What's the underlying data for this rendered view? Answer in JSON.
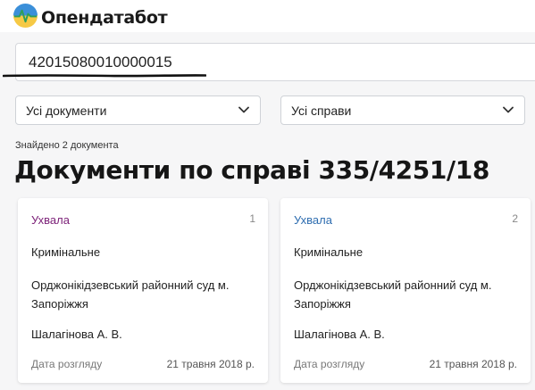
{
  "app": {
    "name": "Опендатабот"
  },
  "search": {
    "value": "42015080010000015"
  },
  "filters": {
    "documents_select": "Усі документи",
    "cases_select": "Усі справи"
  },
  "results": {
    "found_text": "Знайдено 2 документа",
    "title": "Документи по справі 335/4251/18"
  },
  "cards": [
    {
      "number": "1",
      "type": "Ухвала",
      "type_color": "#7b1f77",
      "category": "Кримінальне",
      "court": "Орджонікідзевський районний суд м. Запоріжжя",
      "judge": "Шалагінова А. В.",
      "date_label": "Дата розгляду",
      "date": "21 травня 2018 р."
    },
    {
      "number": "2",
      "type": "Ухвала",
      "type_color": "#2e6db0",
      "category": "Кримінальне",
      "court": "Орджонікідзевський районний суд м. Запоріжжя",
      "judge": "Шалагінова А. В.",
      "date_label": "Дата розгляду",
      "date": "21 травня 2018 р."
    }
  ],
  "colors": {
    "logo_blue": "#3b8fd9",
    "logo_yellow": "#f6c945",
    "logo_green": "#2f9e5a"
  }
}
